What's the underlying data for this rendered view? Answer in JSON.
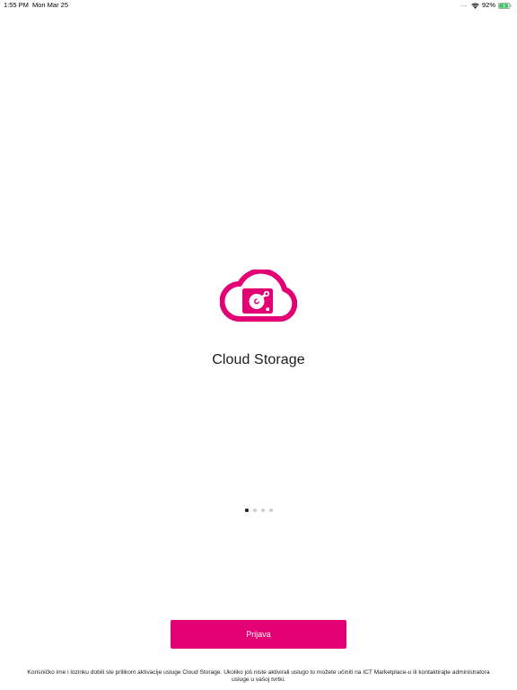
{
  "status_bar": {
    "time": "1:55 PM",
    "date": "Mon Mar 25",
    "signal": "......",
    "battery_percent": "92%",
    "battery_level": 0.92,
    "battery_color": "#34c759"
  },
  "app": {
    "title": "Cloud Storage",
    "brand_color": "#e20074"
  },
  "pager": {
    "count": 4,
    "active_index": 0
  },
  "login": {
    "button_label": "Prijava"
  },
  "footer": {
    "note": "Korisničko ime i lozinku dobili ste prilikom aktivacije usluge Cloud Storage. Ukoliko još niste aktivirali uslugo to možete učiniti na ICT Marketplace-u ili kontaktirajte administratora usluge u vašoj tvrtki."
  },
  "icons": {
    "logo": "cloud-storage-logo",
    "wifi": "wifi-icon",
    "battery": "battery-icon"
  }
}
